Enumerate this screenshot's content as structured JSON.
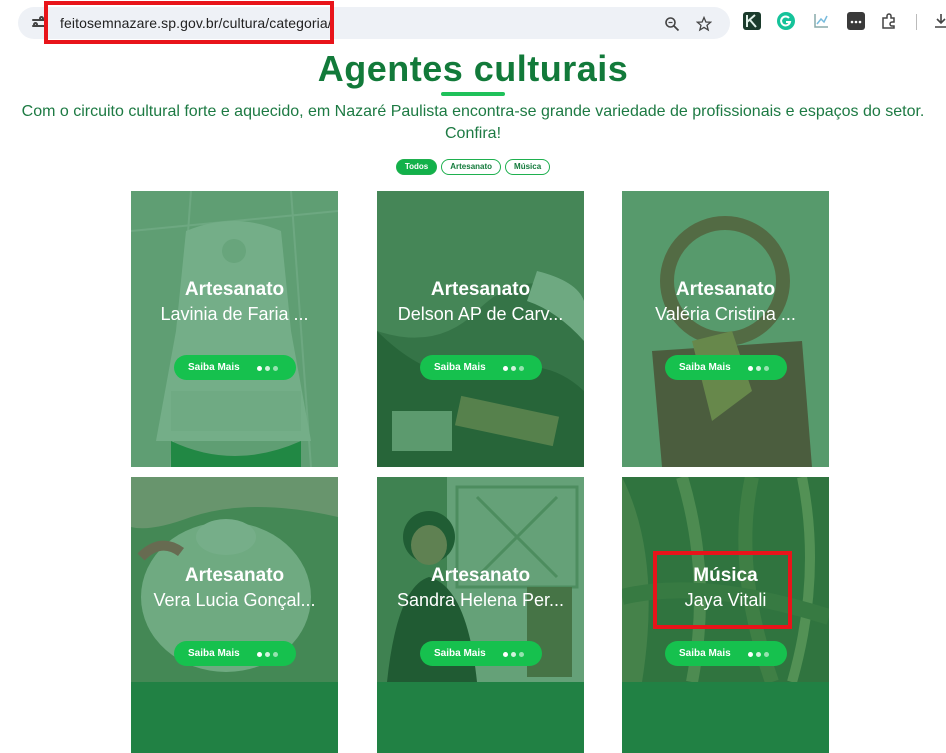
{
  "browser": {
    "url": "feitosemnazare.sp.gov.br/cultura/categoria/"
  },
  "page": {
    "title": "Agentes culturais",
    "subtitle": "Com o circuito cultural forte e aquecido, em Nazaré Paulista encontra-se grande variedade de profissionais e espaços do setor. Confira!",
    "filters": [
      {
        "label": "Todos",
        "active": true
      },
      {
        "label": "Artesanato",
        "active": false
      },
      {
        "label": "Música",
        "active": false
      }
    ]
  },
  "cards": [
    {
      "category": "Artesanato",
      "name": "Lavinia de Faria ...",
      "button": "Saiba Mais"
    },
    {
      "category": "Artesanato",
      "name": "Delson AP de Carv...",
      "button": "Saiba Mais"
    },
    {
      "category": "Artesanato",
      "name": "Valéria Cristina ...",
      "button": "Saiba Mais"
    },
    {
      "category": "Artesanato",
      "name": "Vera Lucia Gonçal...",
      "button": "Saiba Mais"
    },
    {
      "category": "Artesanato",
      "name": "Sandra Helena Per...",
      "button": "Saiba Mais"
    },
    {
      "category": "Música",
      "name": "Jaya Vitali",
      "button": "Saiba Mais"
    }
  ],
  "colors": {
    "brand_green": "#127a3a",
    "accent_green": "#16c14e",
    "highlight_red": "#e8141a"
  }
}
